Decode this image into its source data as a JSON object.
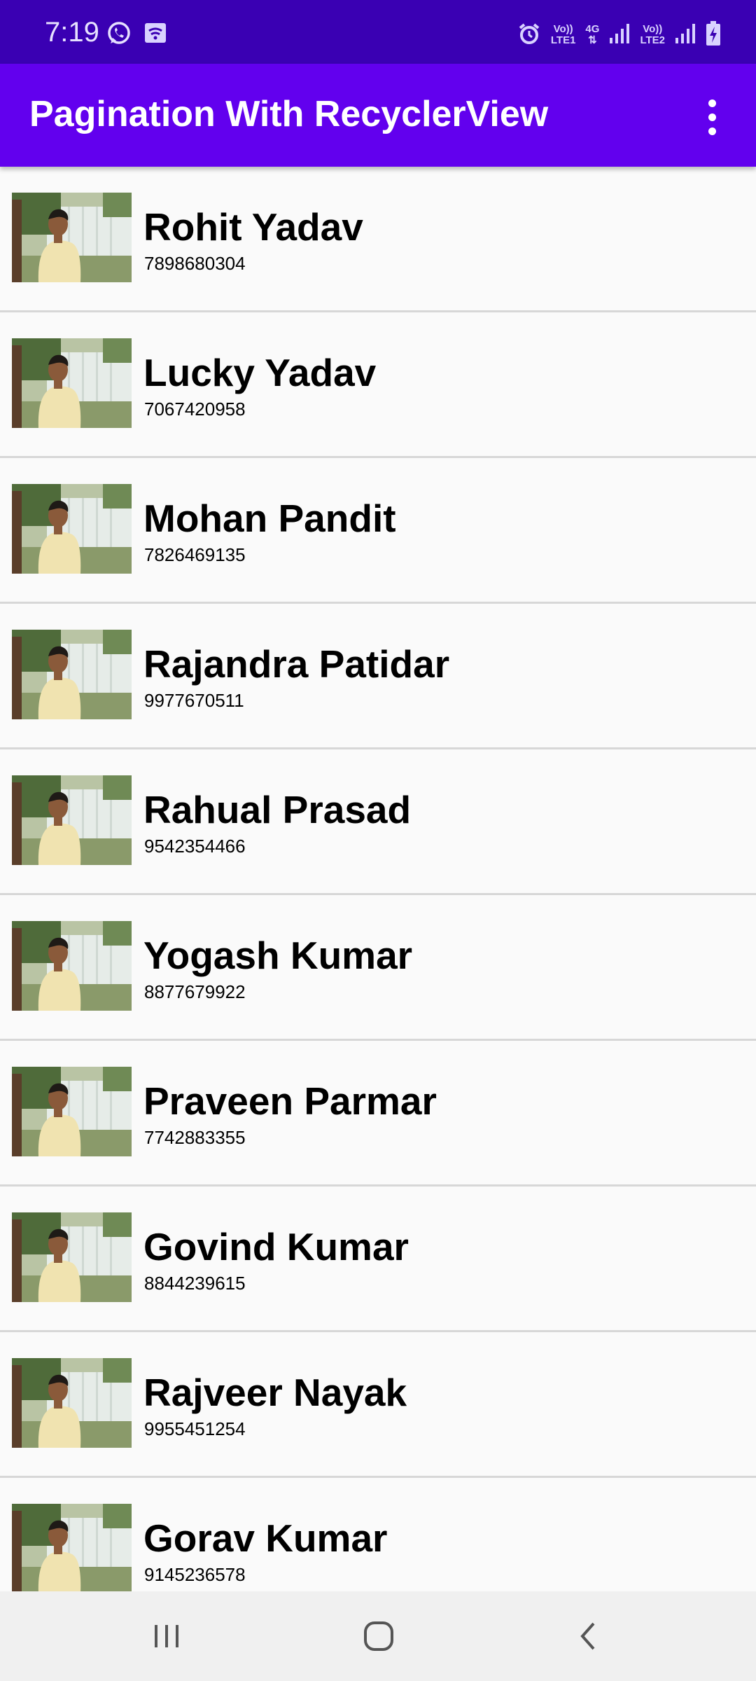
{
  "status_bar": {
    "time": "7:19",
    "icons": [
      "whatsapp-icon",
      "cast-icon",
      "alarm-icon",
      "volte-lte1-icon",
      "4g-icon",
      "signal-icon",
      "volte-lte2-icon",
      "signal-icon",
      "battery-charging-icon"
    ],
    "volte1_top": "Vo))",
    "volte1_bottom": "LTE1",
    "net_type": "4G",
    "volte2_top": "Vo))",
    "volte2_bottom": "LTE2"
  },
  "app_bar": {
    "title": "Pagination With RecyclerView",
    "overflow_icon": "more-vert-icon"
  },
  "list": {
    "items": [
      {
        "name": "Rohit Yadav",
        "phone": "7898680304"
      },
      {
        "name": "Lucky Yadav",
        "phone": "7067420958"
      },
      {
        "name": "Mohan Pandit",
        "phone": "7826469135"
      },
      {
        "name": "Rajandra Patidar",
        "phone": "9977670511"
      },
      {
        "name": "Rahual Prasad",
        "phone": "9542354466"
      },
      {
        "name": "Yogash Kumar",
        "phone": "8877679922"
      },
      {
        "name": "Praveen Parmar",
        "phone": "7742883355"
      },
      {
        "name": "Govind Kumar",
        "phone": "8844239615"
      },
      {
        "name": "Rajveer Nayak",
        "phone": "9955451254"
      },
      {
        "name": "Gorav Kumar",
        "phone": "9145236578"
      }
    ]
  },
  "nav_bar": {
    "recents_icon": "recent-apps-icon",
    "home_icon": "home-icon",
    "back_icon": "back-icon"
  },
  "colors": {
    "status_bar": "#3a00b3",
    "app_bar": "#6200ee",
    "list_bg": "#fafafa",
    "divider": "#d7d7d7",
    "nav_bar": "#f0f0f0"
  }
}
